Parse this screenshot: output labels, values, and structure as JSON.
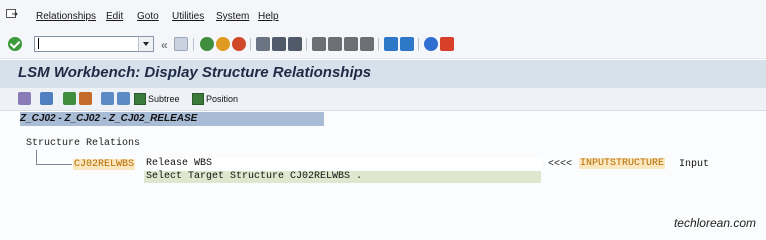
{
  "menu": {
    "items": [
      "Relationships",
      "Edit",
      "Goto",
      "Utilities",
      "System",
      "Help"
    ]
  },
  "toolbar": {
    "command_field_value": "",
    "icons": [
      "enter-icon",
      "command-field",
      "save-icon",
      "back-icon",
      "exit-icon",
      "cancel-icon",
      "print-icon",
      "find-icon",
      "find-next-icon",
      "first-page-icon",
      "previous-page-icon",
      "next-page-icon",
      "last-page-icon",
      "new-session-icon",
      "shortcut-icon",
      "help-icon",
      "customize-icon"
    ]
  },
  "title": "LSM Workbench: Display Structure Relationships",
  "app_toolbar": {
    "subtree_label": "Subtree",
    "position_label": "Position"
  },
  "header_path": "Z_CJ02 - Z_CJ02 - Z_CJ02_RELEASE",
  "tree": {
    "title": "Structure Relations",
    "node_name": "CJ02RELWBS",
    "node_description": "Release WBS",
    "select_prompt": "Select Target Structure CJ02RELWBS .",
    "arrows": "<<<<",
    "source_structure": "INPUTSTRUCTURE",
    "source_label": "Input"
  },
  "watermark": "techlorean.com",
  "colors": {
    "title_bg": "#d7e1ec",
    "path_bg": "#a9bcd6",
    "highlight_bg": "#fbe7bf",
    "highlight_text": "#b36a00",
    "select_row_bg": "#dfe8ce"
  }
}
